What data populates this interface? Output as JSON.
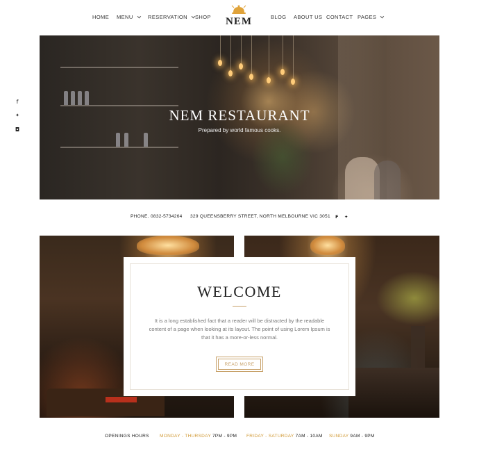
{
  "nav": {
    "left": [
      {
        "label": "HOME",
        "has_dropdown": false
      },
      {
        "label": "MENU",
        "has_dropdown": true
      },
      {
        "label": "RESERVATION",
        "has_dropdown": true
      },
      {
        "label": "SHOP",
        "has_dropdown": false
      }
    ],
    "right": [
      {
        "label": "BLOG",
        "has_dropdown": false
      },
      {
        "label": "ABOUT US",
        "has_dropdown": false
      },
      {
        "label": "CONTACT",
        "has_dropdown": false
      },
      {
        "label": "PAGES",
        "has_dropdown": true
      }
    ],
    "logo_text": "NEM",
    "logo_icon": "serving-cloche-icon",
    "logo_color": "#e0a33a"
  },
  "social_sidebar": [
    {
      "icon": "facebook-icon",
      "glyph": "f"
    },
    {
      "icon": "twitter-icon",
      "glyph": "🐦"
    },
    {
      "icon": "instagram-icon",
      "glyph": "◘"
    }
  ],
  "hero": {
    "title": "NEM RESTAURANT",
    "subtitle": "Prepared by world famous cooks."
  },
  "contact": {
    "phone_label": "PHONE.",
    "phone": "0832-5734264",
    "address": "329 QUEENSBERRY STREET, NORTH MELBOURNE VIC 3051",
    "icons": [
      "facebook-icon",
      "twitter-icon"
    ]
  },
  "welcome": {
    "title": "WELCOME",
    "text": "It is a long established fact that a reader will be distracted by the readable content of a page when looking at its layout. The point of using Lorem Ipsum is that it has a more-or-less normal.",
    "button": "READ MORE"
  },
  "hours": {
    "label": "OPENINGS HOURS",
    "groups": [
      {
        "days_a": "MONDAY",
        "sep": " - ",
        "days_b": "THURSDAY",
        "time": "7PM - 9PM"
      },
      {
        "days_a": "FRIDAY",
        "sep": " - ",
        "days_b": "SATURDAY",
        "time": "7AM - 10AM"
      },
      {
        "days_a": "SUNDAY",
        "sep": "",
        "days_b": "",
        "time": "9AM - 9PM"
      }
    ]
  },
  "colors": {
    "accent": "#d19a36",
    "text": "#222222",
    "muted": "#777777"
  }
}
